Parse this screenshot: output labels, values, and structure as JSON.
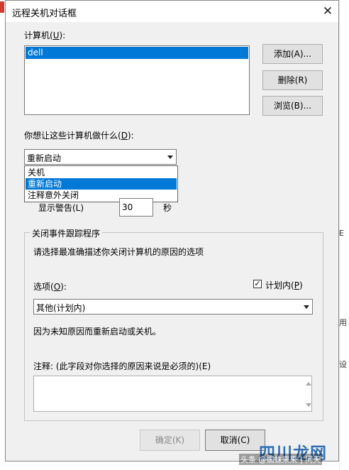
{
  "dialog": {
    "title": "远程关机对话框",
    "close_glyph": "✕"
  },
  "computers": {
    "label": "计算机(",
    "label_key": "U",
    "label_end": "):",
    "items": [
      "dell"
    ]
  },
  "buttons": {
    "add": "添加(A)...",
    "delete": "删除(R)",
    "browse": "浏览(B)...",
    "ok": "确定(K)",
    "cancel": "取消(C)"
  },
  "action": {
    "label": "你想让这些计算机做什么(",
    "label_key": "D",
    "label_end": "):",
    "selected": "重新启动",
    "options": [
      "关机",
      "重新启动",
      "注释意外关闭"
    ],
    "highlighted_index": 1
  },
  "warning": {
    "label": "显示警告(L)",
    "value": "30",
    "unit": "秒"
  },
  "tracker": {
    "group_title": "关闭事件跟踪程序",
    "instruction": "请选择最准确描述你关闭计算机的原因的选项",
    "option_label": "选项(",
    "option_key": "O",
    "option_end": "):",
    "planned_label": "计划内(",
    "planned_key": "P",
    "planned_end": ")",
    "planned_checked": true,
    "reason_selected": "其他(计划内)",
    "reason_description": "因为未知原因而重新启动或关机。",
    "comment_label": "注释: (此字段对你选择的原因来说是必须的)(E)"
  },
  "watermark": {
    "main": "四川龙网",
    "sub": "头条 @蜘蛛来来 | 问天"
  },
  "background": {
    "edge_chars": [
      "E",
      "用",
      "设"
    ]
  },
  "colors": {
    "selection": "#0078d7",
    "dialog_bg": "#f0f0f0",
    "button_bg": "#e1e1e1"
  }
}
